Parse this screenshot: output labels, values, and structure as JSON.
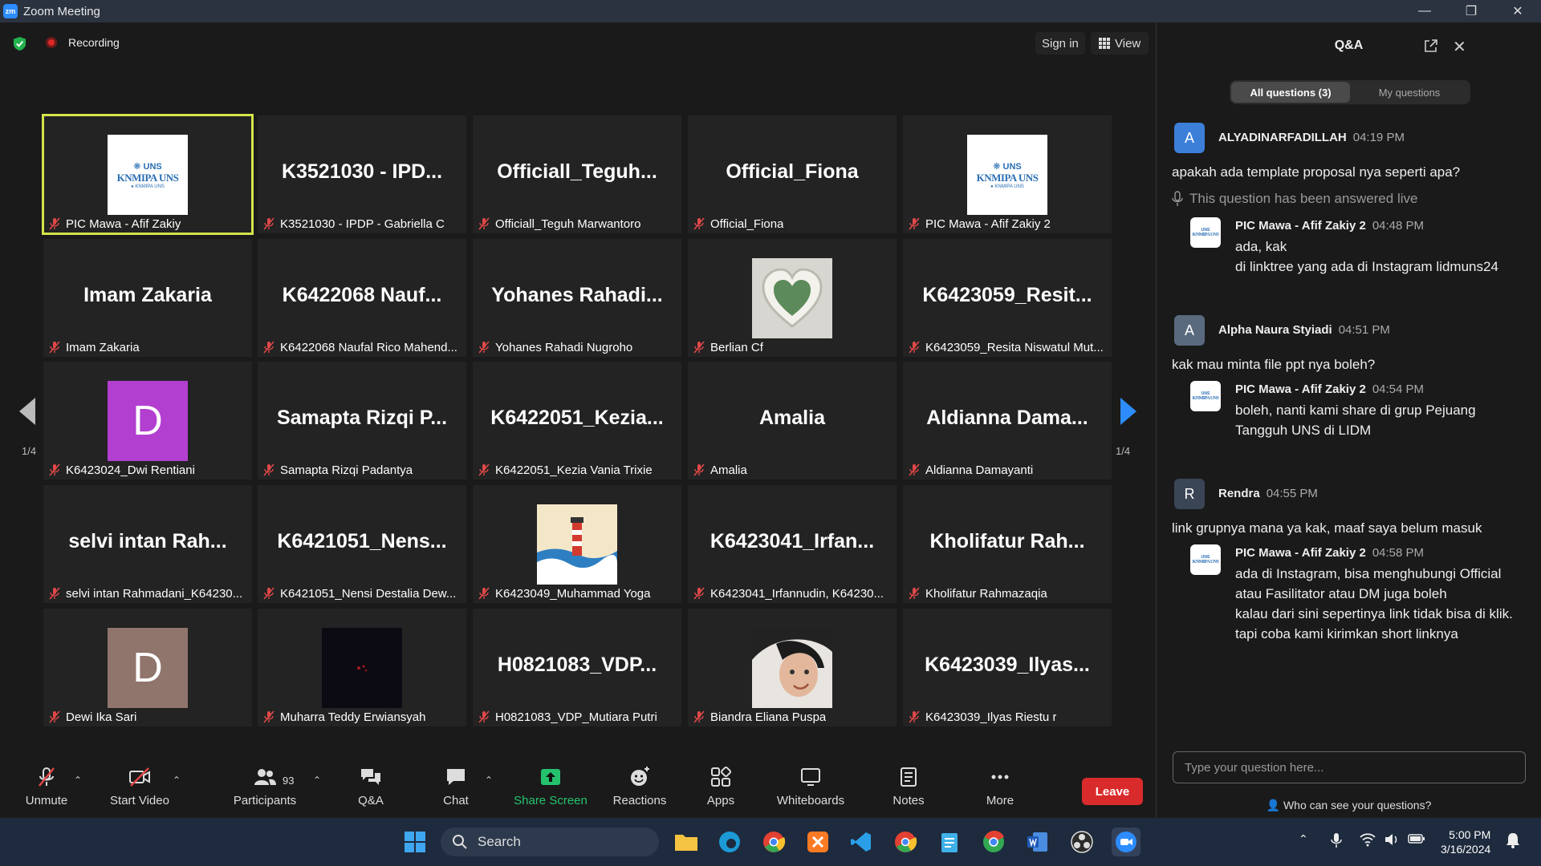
{
  "window": {
    "title": "Zoom Meeting",
    "app_logo": "zm"
  },
  "topbar": {
    "recording_label": "Recording",
    "sign_in": "Sign in",
    "view": "View"
  },
  "colors": {
    "active_speaker": "#d4e44a",
    "share_green": "#25c26e",
    "leave_red": "#d92b2b",
    "purple_avatar": "#b23fd0",
    "brown_avatar": "#8f756c",
    "qa_avatar_blue": "#3b7fd9",
    "qa_avatar_gray": "#5a6a7e",
    "qa_avatar_dark": "#3a4556"
  },
  "gallery": {
    "page_left": "1/4",
    "page_right": "1/4",
    "tiles": [
      {
        "big": "",
        "name": "PIC Mawa - Afif Zakiy",
        "pic": "uns",
        "active": true
      },
      {
        "big": "K3521030 - IPD...",
        "name": "K3521030 - IPDP - Gabriella C"
      },
      {
        "big": "Officiall_Teguh...",
        "name": "Officiall_Teguh Marwantoro"
      },
      {
        "big": "Official_Fiona",
        "name": "Official_Fiona"
      },
      {
        "big": "",
        "name": "PIC Mawa - Afif Zakiy 2",
        "pic": "uns"
      },
      {
        "big": "Imam Zakaria",
        "name": "Imam Zakaria"
      },
      {
        "big": "K6422068 Nauf...",
        "name": "K6422068 Naufal Rico Mahend..."
      },
      {
        "big": "Yohanes Rahadi...",
        "name": "Yohanes Rahadi Nugroho"
      },
      {
        "big": "",
        "name": "Berlian Cf",
        "pic": "heart"
      },
      {
        "big": "K6423059_Resit...",
        "name": "K6423059_Resita Niswatul Mut..."
      },
      {
        "big": "",
        "name": "K6423024_Dwi Rentiani",
        "pic": "letter",
        "letter": "D",
        "color": "purple"
      },
      {
        "big": "Samapta Rizqi P...",
        "name": "Samapta Rizqi Padantya"
      },
      {
        "big": "K6422051_Kezia...",
        "name": "K6422051_Kezia Vania Trixie"
      },
      {
        "big": "Amalia",
        "name": "Amalia"
      },
      {
        "big": "Aldianna Dama...",
        "name": "Aldianna Damayanti"
      },
      {
        "big": "selvi intan Rah...",
        "name": "selvi intan Rahmadani_K64230..."
      },
      {
        "big": "K6421051_Nens...",
        "name": "K6421051_Nensi Destalia Dew..."
      },
      {
        "big": "",
        "name": "K6423049_Muhammad Yoga",
        "pic": "lighthouse"
      },
      {
        "big": "K6423041_Irfan...",
        "name": "K6423041_Irfannudin, K64230..."
      },
      {
        "big": "Kholifatur Rah...",
        "name": "Kholifatur Rahmazaqia"
      },
      {
        "big": "",
        "name": "Dewi Ika Sari",
        "pic": "letter",
        "letter": "D",
        "color": "brown"
      },
      {
        "big": "",
        "name": "Muharra Teddy Erwiansyah",
        "pic": "dark"
      },
      {
        "big": "H0821083_VDP...",
        "name": "H0821083_VDP_Mutiara Putri"
      },
      {
        "big": "",
        "name": "Biandra Eliana Puspa",
        "pic": "selfie"
      },
      {
        "big": "K6423039_Ilyas...",
        "name": "K6423039_Ilyas Riestu r"
      }
    ]
  },
  "toolbar": {
    "unmute": "Unmute",
    "start_video": "Start Video",
    "participants": "Participants",
    "participants_count": "93",
    "qa": "Q&A",
    "chat": "Chat",
    "share_screen": "Share Screen",
    "reactions": "Reactions",
    "apps": "Apps",
    "whiteboards": "Whiteboards",
    "notes": "Notes",
    "more": "More",
    "leave": "Leave"
  },
  "qa_panel": {
    "title": "Q&A",
    "tab_all": "All questions (3)",
    "tab_mine": "My questions",
    "answered_live": "This question has been answered live",
    "questions": [
      {
        "initial": "A",
        "author": "ALYADINARFADILLAH",
        "time": "04:19 PM",
        "text": "apakah ada template proposal nya seperti apa?",
        "answer_author": "PIC Mawa - Afif Zakiy 2",
        "answer_time": "04:48 PM",
        "answer": "ada, kak\ndi linktree yang ada di Instagram lidmuns24"
      },
      {
        "initial": "A",
        "author": "Alpha Naura Styiadi",
        "time": "04:51 PM",
        "text": "kak mau minta file ppt nya boleh?",
        "answer_author": "PIC Mawa - Afif Zakiy 2",
        "answer_time": "04:54 PM",
        "answer": "boleh, nanti kami share di grup Pejuang\nTangguh UNS di LIDM"
      },
      {
        "initial": "R",
        "author": "Rendra",
        "time": "04:55 PM",
        "text": "link grupnya mana ya kak, maaf saya belum masuk",
        "answer_author": "PIC Mawa - Afif Zakiy 2",
        "answer_time": "04:58 PM",
        "answer": "ada di Instagram, bisa menghubungi Official\natau Fasilitator atau DM juga boleh\nkalau dari sini sepertinya link tidak bisa di klik.\ntapi coba kami kirimkan short linknya"
      }
    ],
    "input_placeholder": "Type your question here...",
    "who_can_see": "Who can see your questions?"
  },
  "taskbar": {
    "search": "Search",
    "time": "5:00 PM",
    "date": "3/16/2024"
  }
}
